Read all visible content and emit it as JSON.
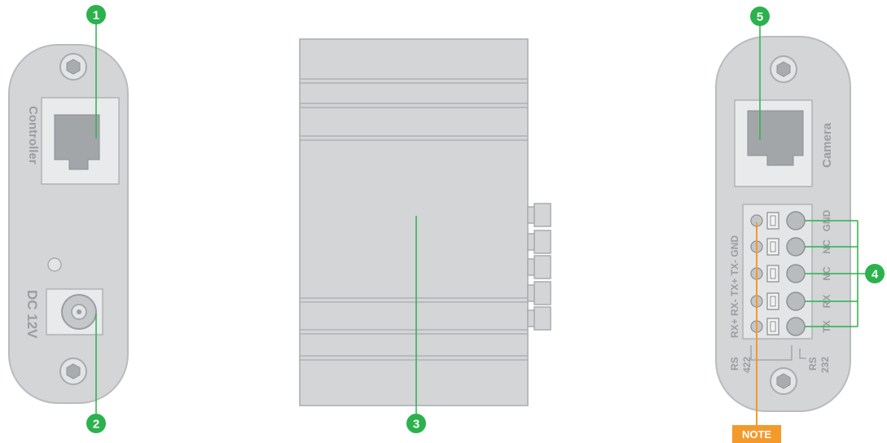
{
  "colors": {
    "callout": "#2bb24c",
    "note": "#f39a2b",
    "panel_fill": "#d3d5d7",
    "panel_stroke": "#b9bcbf",
    "text": "#9a9da1"
  },
  "left_panel": {
    "port_label": "Controller",
    "power_label": "DC 12V"
  },
  "right_panel": {
    "port_label": "Camera",
    "rs422_pins": "RX+ RX- TX+ TX- GND",
    "rs232_pins": [
      "TX",
      "RX",
      "NC",
      "NC",
      "GND"
    ],
    "rs422_label_a": "RS",
    "rs422_label_b": "422",
    "rs232_label_a": "RS",
    "rs232_label_b": "232"
  },
  "callouts": [
    "1",
    "2",
    "3",
    "4",
    "5"
  ],
  "note_label": "NOTE"
}
